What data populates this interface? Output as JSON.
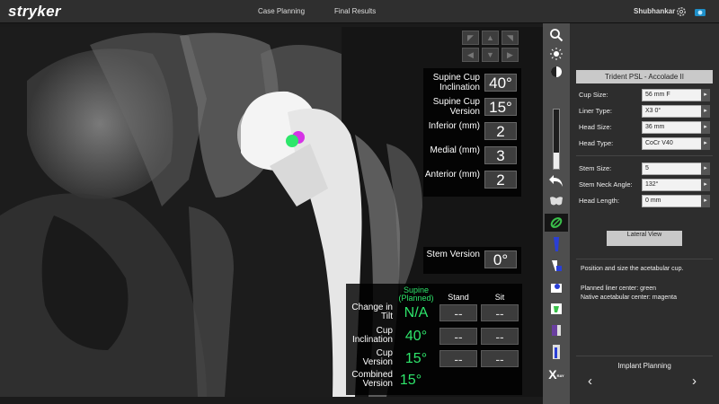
{
  "header": {
    "logo": "stryker",
    "tabs": [
      {
        "label": "Case Planning"
      },
      {
        "label": "Final Results"
      }
    ],
    "user": "Shubhankar",
    "icons": [
      "gear-icon",
      "camera-icon"
    ]
  },
  "measurements": [
    {
      "label": "Supine Cup Inclination",
      "value": "40°"
    },
    {
      "label": "Supine Cup Version",
      "value": "15°"
    },
    {
      "label": "Inferior (mm)",
      "value": "2"
    },
    {
      "label": "Medial (mm)",
      "value": "3"
    },
    {
      "label": "Anterior (mm)",
      "value": "2"
    }
  ],
  "stem_version": {
    "label": "Stem Version",
    "value": "0°"
  },
  "tilt_table": {
    "headers": {
      "supine": "Supine (Planned)",
      "stand": "Stand",
      "sit": "Sit"
    },
    "rows": [
      {
        "label": "Change in Tilt",
        "supine": "N/A",
        "stand": "--",
        "sit": "--"
      },
      {
        "label": "Cup Inclination",
        "supine": "40°",
        "stand": "--",
        "sit": "--"
      },
      {
        "label": "Cup Version",
        "supine": "15°",
        "stand": "--",
        "sit": "--"
      },
      {
        "label": "Combined Version",
        "supine": "15°"
      }
    ]
  },
  "toolbar": {
    "icons": [
      "zoom-icon",
      "brightness-icon",
      "contrast-icon",
      "undo-icon",
      "pelvis-icon",
      "cup-icon",
      "stem-icon",
      "femur-icon",
      "head-icon",
      "implant-icon",
      "femur-offset-icon",
      "leg-length-icon",
      "x-ray-icon"
    ],
    "slider_level": 0.27,
    "xray_label": "X",
    "xray_sub": "RAY"
  },
  "right_panel": {
    "section_title": "Trident PSL - Accolade II",
    "fields": [
      {
        "label": "Cup Size:",
        "value": "56 mm F"
      },
      {
        "label": "Liner Type:",
        "value": "X3 0°"
      },
      {
        "label": "Head Size:",
        "value": "36 mm"
      },
      {
        "label": "Head Type:",
        "value": "CoCr V40"
      },
      {
        "label": "Stem Size:",
        "value": "5"
      },
      {
        "label": "Stem Neck Angle:",
        "value": "132°"
      },
      {
        "label": "Head Length:",
        "value": "0 mm"
      }
    ],
    "lateral_button": "Lateral View",
    "info_lines": [
      "Position and size the acetabular cup.",
      "Planned liner center: green",
      "Native acetabular center: magenta"
    ],
    "footer_title": "Implant Planning",
    "prev_label": "‹",
    "next_label": "›"
  },
  "colors": {
    "green": "#2ee66b",
    "magenta": "#d633e6",
    "toolbar_green": "#3ac14a"
  }
}
